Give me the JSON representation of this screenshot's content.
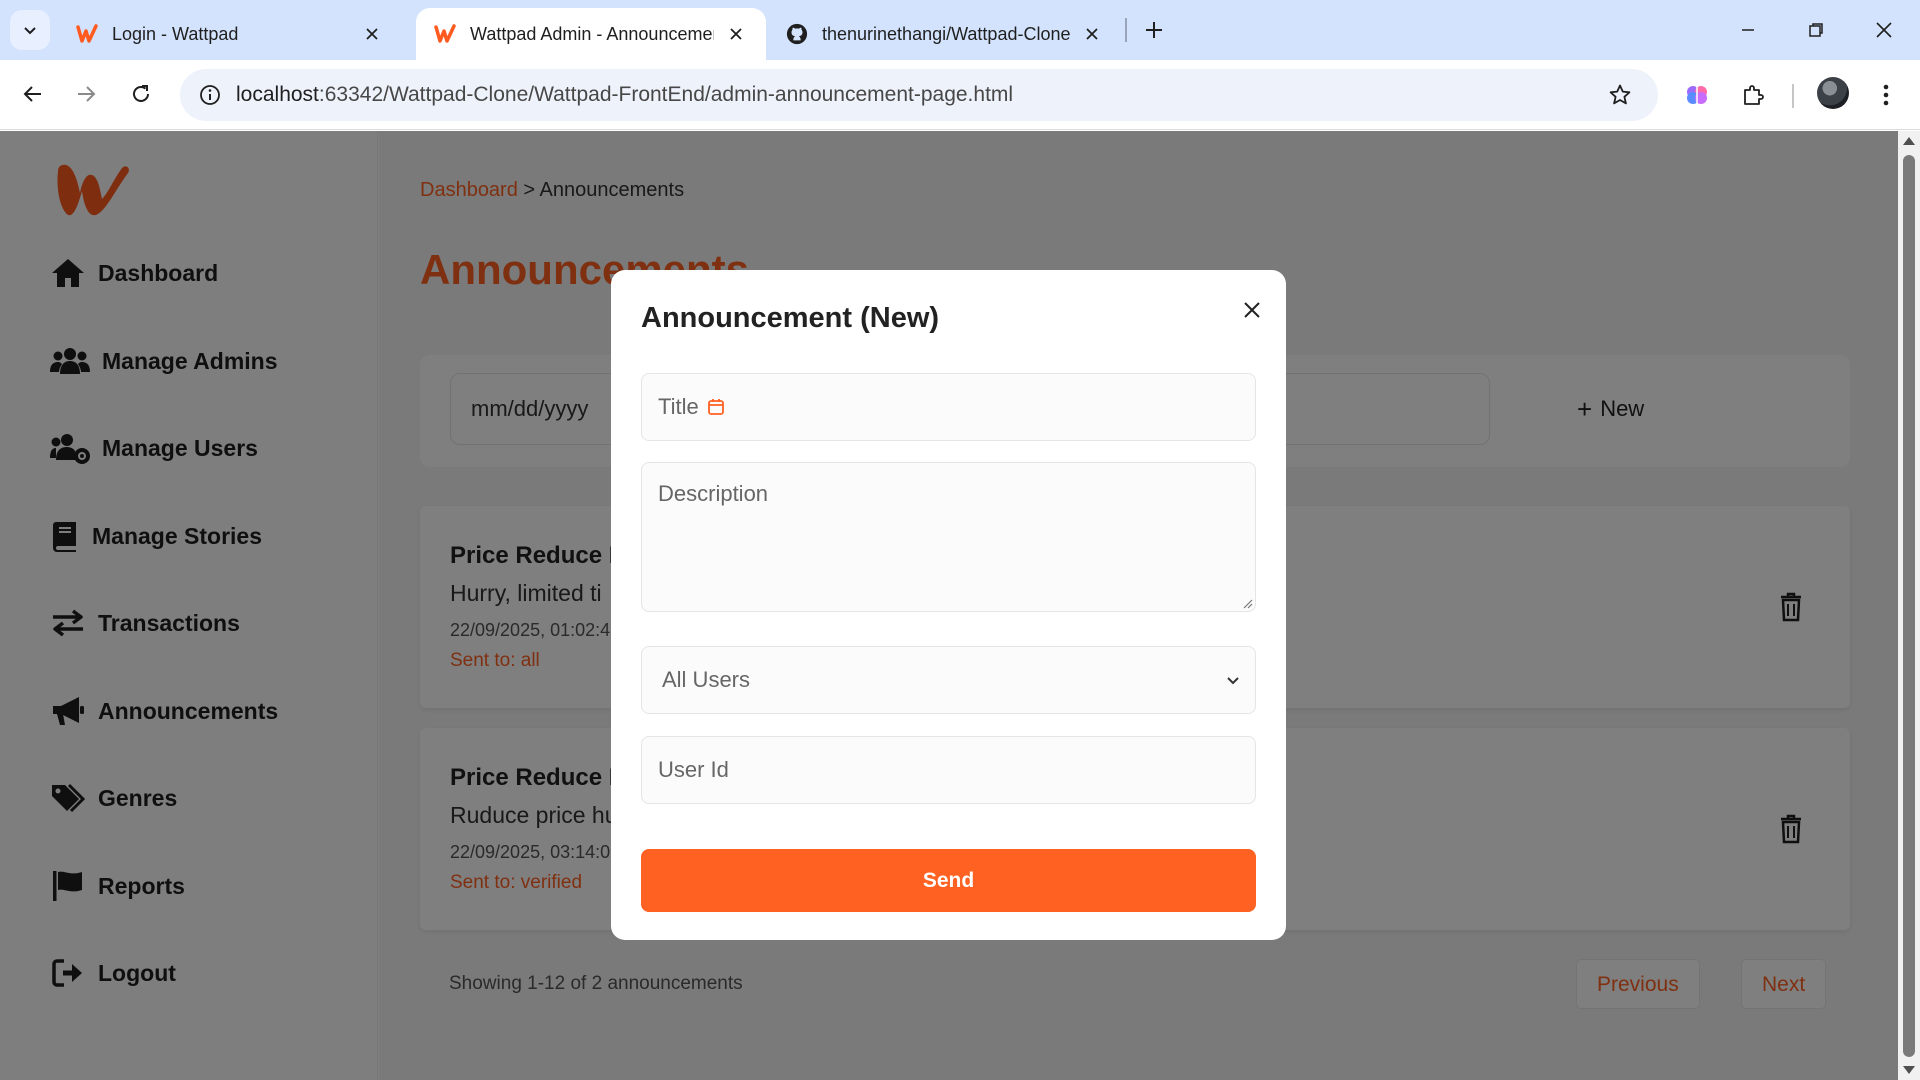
{
  "browser": {
    "tabs": [
      {
        "title": "Login - Wattpad",
        "favicon": "wattpad-icon",
        "active": false
      },
      {
        "title": "Wattpad Admin - Announcements",
        "favicon": "wattpad-icon",
        "active": true
      },
      {
        "title": "thenurinethangi/Wattpad-Clone",
        "favicon": "github-icon",
        "active": false
      }
    ],
    "url_host": "localhost",
    "url_path": ":63342/Wattpad-Clone/Wattpad-FrontEnd/admin-announcement-page.html"
  },
  "sidebar": {
    "items": [
      {
        "label": "Dashboard",
        "icon": "home-icon"
      },
      {
        "label": "Manage Admins",
        "icon": "users-icon"
      },
      {
        "label": "Manage Users",
        "icon": "users-cog-icon"
      },
      {
        "label": "Manage Stories",
        "icon": "book-icon"
      },
      {
        "label": "Transactions",
        "icon": "exchange-icon"
      },
      {
        "label": "Announcements",
        "icon": "megaphone-icon"
      },
      {
        "label": "Genres",
        "icon": "tags-icon"
      },
      {
        "label": "Reports",
        "icon": "flag-icon"
      },
      {
        "label": "Logout",
        "icon": "logout-icon"
      }
    ]
  },
  "main": {
    "breadcrumb": {
      "link": "Dashboard",
      "separator": " > ",
      "current": "Announcements"
    },
    "title": "Announcements",
    "filter": {
      "date_placeholder": "mm/dd/yyyy",
      "new_label": "New"
    },
    "announcements": [
      {
        "title": "Price Reduce F",
        "description": "Hurry, limited ti",
        "date": "22/09/2025, 01:02:4",
        "sent_to": "Sent to: all"
      },
      {
        "title": "Price Reduce F",
        "description": "Ruduce price hu",
        "date": "22/09/2025, 03:14:0",
        "sent_to": "Sent to: verified"
      }
    ],
    "pagination": {
      "info": "Showing 1-12 of 2 announcements",
      "previous": "Previous",
      "next": "Next"
    }
  },
  "modal": {
    "title": "Announcement (New)",
    "title_placeholder": "Title",
    "description_placeholder": "Description",
    "audience_selected": "All Users",
    "user_id_placeholder": "User Id",
    "send_label": "Send"
  },
  "colors": {
    "accent": "#ff6122",
    "tabstrip": "#d3e3fd",
    "overlay": "rgba(0,0,0,0.5)"
  }
}
